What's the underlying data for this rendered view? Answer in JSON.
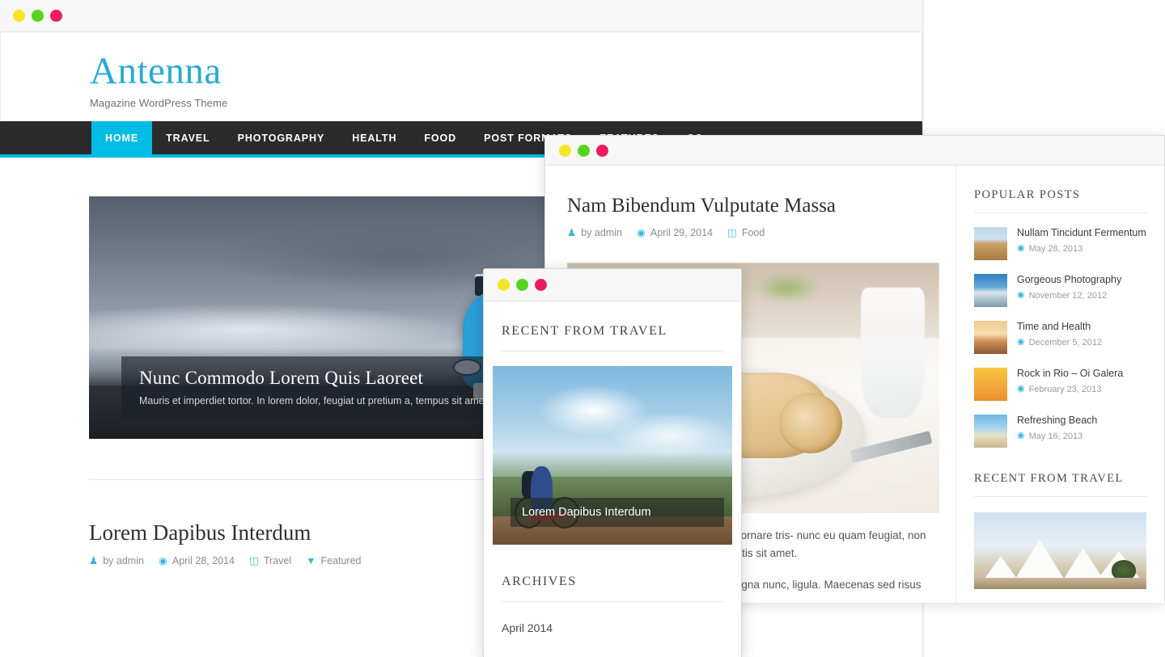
{
  "theme": {
    "accent": "#00bbe4",
    "logo_color": "#29abd1",
    "nav_bg": "#2b2b2b",
    "dot_yellow": "#f4e626",
    "dot_green": "#55d41e",
    "dot_red": "#ec1c62"
  },
  "window1": {
    "site_title": "Antenna",
    "tagline": "Magazine WordPress Theme",
    "nav": [
      {
        "label": "HOME",
        "active": true
      },
      {
        "label": "TRAVEL",
        "active": false
      },
      {
        "label": "PHOTOGRAPHY",
        "active": false
      },
      {
        "label": "HEALTH",
        "active": false
      },
      {
        "label": "FOOD",
        "active": false
      },
      {
        "label": "POST FORMATS",
        "active": false
      },
      {
        "label": "FEATURES",
        "active": false
      },
      {
        "label": "CO",
        "active": false
      }
    ],
    "hero": {
      "image": "blue-toy-car-on-road",
      "title": "Nunc Commodo Lorem Quis Laoreet",
      "excerpt": "Mauris et imperdiet tortor. In lorem dolor, feugiat ut pretium a, tempus sit amet mag"
    },
    "post": {
      "title": "Lorem Dapibus Interdum",
      "meta": {
        "author": "by admin",
        "date": "April 28, 2014",
        "category": "Travel",
        "tag": "Featured"
      }
    }
  },
  "window2": {
    "post": {
      "title": "Nam Bibendum Vulputate Massa",
      "meta": {
        "author": "by admin",
        "date": "April 29, 2014",
        "category": "Food"
      },
      "image": "table-setting-napkin-plate",
      "paragraph1": "hendrerit sem sagittis sit amet. Sed ornare tris- nunc eu quam feugiat, non auctor risus fringilla. at enim venenatis sit amet.",
      "paragraph2": "amet, pellentesque eu lectus. Ut magna nunc, ligula. Maecenas sed risus tellus. Aliquam ac au-"
    },
    "sidebar": {
      "popular_heading": "POPULAR POSTS",
      "popular_posts": [
        {
          "title": "Nullam Tincidunt Fermentum",
          "date": "May 28, 2013",
          "thumb": "desert-dunes"
        },
        {
          "title": "Gorgeous Photography",
          "date": "November 12, 2012",
          "thumb": "pier-sea"
        },
        {
          "title": "Time and Health",
          "date": "December 5, 2012",
          "thumb": "beach-jump"
        },
        {
          "title": "Rock in Rio – Oi Galera",
          "date": "February 23, 2013",
          "thumb": "concert-crowd"
        },
        {
          "title": "Refreshing Beach",
          "date": "May 16, 2013",
          "thumb": "beach-chairs"
        }
      ],
      "recent_heading": "RECENT FROM TRAVEL",
      "recent_image": "white-tents-sydney-opera"
    }
  },
  "window3": {
    "heading": "RECENT FROM TRAVEL",
    "card": {
      "image": "cyclist-on-mountain",
      "caption": "Lorem Dapibus Interdum"
    },
    "archives_heading": "ARCHIVES",
    "archives": [
      {
        "label": "April 2014"
      }
    ]
  },
  "icons": {
    "author": "person-icon",
    "date": "clock-icon",
    "category": "folder-icon",
    "tag": "pin-icon"
  }
}
